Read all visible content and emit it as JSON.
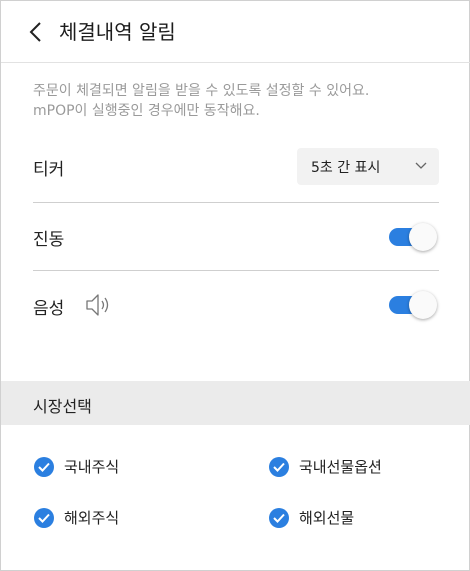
{
  "header": {
    "title": "체결내역 알림"
  },
  "description": {
    "line1": "주문이 체결되면 알림을 받을 수 있도록 설정할 수 있어요.",
    "line2": "mPOP이 실행중인 경우에만 동작해요."
  },
  "settings": {
    "ticker": {
      "label": "티커",
      "selected": "5초 간 표시"
    },
    "vibration": {
      "label": "진동",
      "on": true
    },
    "sound": {
      "label": "음성",
      "on": true
    }
  },
  "market": {
    "title": "시장선택",
    "options": [
      {
        "label": "국내주식",
        "checked": true
      },
      {
        "label": "국내선물옵션",
        "checked": true
      },
      {
        "label": "해외주식",
        "checked": true
      },
      {
        "label": "해외선물",
        "checked": true
      }
    ]
  },
  "colors": {
    "accent": "#2b7fe0",
    "section_bg": "#ebebeb",
    "muted_text": "#9a9a9a"
  }
}
